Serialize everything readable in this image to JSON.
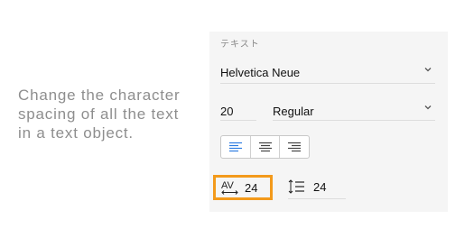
{
  "caption": {
    "line1": "Change the character",
    "line2": "spacing of all the text",
    "line3": "in a text object."
  },
  "panel": {
    "section_title": "テキスト",
    "font_family": "Helvetica Neue",
    "font_size": "20",
    "font_weight": "Regular",
    "alignment_options": [
      "align-left",
      "align-center",
      "align-right"
    ],
    "selected_alignment": "align-left",
    "character_spacing_icon_label": "AV",
    "character_spacing": "24",
    "line_height": "24"
  },
  "colors": {
    "highlight": "#f39a1b",
    "active_align": "#2f7de1",
    "caption_text": "#8e8e8e"
  }
}
